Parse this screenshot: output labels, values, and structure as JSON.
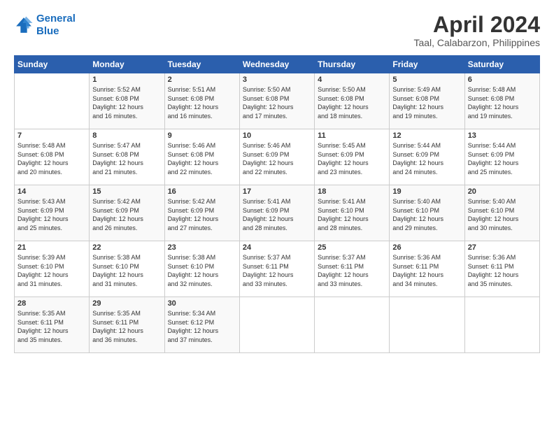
{
  "logo": {
    "line1": "General",
    "line2": "Blue"
  },
  "title": "April 2024",
  "subtitle": "Taal, Calabarzon, Philippines",
  "header": {
    "days": [
      "Sunday",
      "Monday",
      "Tuesday",
      "Wednesday",
      "Thursday",
      "Friday",
      "Saturday"
    ]
  },
  "weeks": [
    [
      {
        "day": "",
        "content": ""
      },
      {
        "day": "1",
        "content": "Sunrise: 5:52 AM\nSunset: 6:08 PM\nDaylight: 12 hours\nand 16 minutes."
      },
      {
        "day": "2",
        "content": "Sunrise: 5:51 AM\nSunset: 6:08 PM\nDaylight: 12 hours\nand 16 minutes."
      },
      {
        "day": "3",
        "content": "Sunrise: 5:50 AM\nSunset: 6:08 PM\nDaylight: 12 hours\nand 17 minutes."
      },
      {
        "day": "4",
        "content": "Sunrise: 5:50 AM\nSunset: 6:08 PM\nDaylight: 12 hours\nand 18 minutes."
      },
      {
        "day": "5",
        "content": "Sunrise: 5:49 AM\nSunset: 6:08 PM\nDaylight: 12 hours\nand 19 minutes."
      },
      {
        "day": "6",
        "content": "Sunrise: 5:48 AM\nSunset: 6:08 PM\nDaylight: 12 hours\nand 19 minutes."
      }
    ],
    [
      {
        "day": "7",
        "content": "Sunrise: 5:48 AM\nSunset: 6:08 PM\nDaylight: 12 hours\nand 20 minutes."
      },
      {
        "day": "8",
        "content": "Sunrise: 5:47 AM\nSunset: 6:08 PM\nDaylight: 12 hours\nand 21 minutes."
      },
      {
        "day": "9",
        "content": "Sunrise: 5:46 AM\nSunset: 6:08 PM\nDaylight: 12 hours\nand 22 minutes."
      },
      {
        "day": "10",
        "content": "Sunrise: 5:46 AM\nSunset: 6:09 PM\nDaylight: 12 hours\nand 22 minutes."
      },
      {
        "day": "11",
        "content": "Sunrise: 5:45 AM\nSunset: 6:09 PM\nDaylight: 12 hours\nand 23 minutes."
      },
      {
        "day": "12",
        "content": "Sunrise: 5:44 AM\nSunset: 6:09 PM\nDaylight: 12 hours\nand 24 minutes."
      },
      {
        "day": "13",
        "content": "Sunrise: 5:44 AM\nSunset: 6:09 PM\nDaylight: 12 hours\nand 25 minutes."
      }
    ],
    [
      {
        "day": "14",
        "content": "Sunrise: 5:43 AM\nSunset: 6:09 PM\nDaylight: 12 hours\nand 25 minutes."
      },
      {
        "day": "15",
        "content": "Sunrise: 5:42 AM\nSunset: 6:09 PM\nDaylight: 12 hours\nand 26 minutes."
      },
      {
        "day": "16",
        "content": "Sunrise: 5:42 AM\nSunset: 6:09 PM\nDaylight: 12 hours\nand 27 minutes."
      },
      {
        "day": "17",
        "content": "Sunrise: 5:41 AM\nSunset: 6:09 PM\nDaylight: 12 hours\nand 28 minutes."
      },
      {
        "day": "18",
        "content": "Sunrise: 5:41 AM\nSunset: 6:10 PM\nDaylight: 12 hours\nand 28 minutes."
      },
      {
        "day": "19",
        "content": "Sunrise: 5:40 AM\nSunset: 6:10 PM\nDaylight: 12 hours\nand 29 minutes."
      },
      {
        "day": "20",
        "content": "Sunrise: 5:40 AM\nSunset: 6:10 PM\nDaylight: 12 hours\nand 30 minutes."
      }
    ],
    [
      {
        "day": "21",
        "content": "Sunrise: 5:39 AM\nSunset: 6:10 PM\nDaylight: 12 hours\nand 31 minutes."
      },
      {
        "day": "22",
        "content": "Sunrise: 5:38 AM\nSunset: 6:10 PM\nDaylight: 12 hours\nand 31 minutes."
      },
      {
        "day": "23",
        "content": "Sunrise: 5:38 AM\nSunset: 6:10 PM\nDaylight: 12 hours\nand 32 minutes."
      },
      {
        "day": "24",
        "content": "Sunrise: 5:37 AM\nSunset: 6:11 PM\nDaylight: 12 hours\nand 33 minutes."
      },
      {
        "day": "25",
        "content": "Sunrise: 5:37 AM\nSunset: 6:11 PM\nDaylight: 12 hours\nand 33 minutes."
      },
      {
        "day": "26",
        "content": "Sunrise: 5:36 AM\nSunset: 6:11 PM\nDaylight: 12 hours\nand 34 minutes."
      },
      {
        "day": "27",
        "content": "Sunrise: 5:36 AM\nSunset: 6:11 PM\nDaylight: 12 hours\nand 35 minutes."
      }
    ],
    [
      {
        "day": "28",
        "content": "Sunrise: 5:35 AM\nSunset: 6:11 PM\nDaylight: 12 hours\nand 35 minutes."
      },
      {
        "day": "29",
        "content": "Sunrise: 5:35 AM\nSunset: 6:11 PM\nDaylight: 12 hours\nand 36 minutes."
      },
      {
        "day": "30",
        "content": "Sunrise: 5:34 AM\nSunset: 6:12 PM\nDaylight: 12 hours\nand 37 minutes."
      },
      {
        "day": "",
        "content": ""
      },
      {
        "day": "",
        "content": ""
      },
      {
        "day": "",
        "content": ""
      },
      {
        "day": "",
        "content": ""
      }
    ]
  ]
}
